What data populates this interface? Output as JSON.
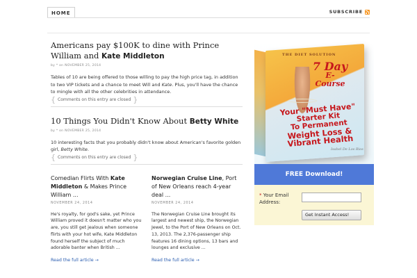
{
  "nav": {
    "home": "HOME",
    "subscribe": "SUBSCRIBE"
  },
  "posts": [
    {
      "title_plain": "Americans pay $100K to dine with Prince William and ",
      "title_bold": "Kate Middleton",
      "meta": "by * on NOVEMBER 25, 2014",
      "excerpt_pre": "Tables of 10 are being offered to those willing to pay the high price tag, in addition to two VIP tickets and a chance to meet Will and ",
      "excerpt_em": "Kate",
      "excerpt_post": ". Plus, you'll have the chance to mingle with all the other celebrities in attendance.",
      "comments": "Comments on this entry are closed"
    },
    {
      "title_plain": "10 Things You Didn't Know About ",
      "title_bold": "Betty White",
      "meta": "by * on NOVEMBER 25, 2014",
      "excerpt_pre": "10 interesting facts that you probably didn't know about American's favorite golden girl, ",
      "excerpt_em": "Betty White",
      "excerpt_post": ".",
      "comments": "Comments on this entry are closed"
    }
  ],
  "columns": [
    {
      "title_pre": "Comedian Flirts With ",
      "title_bold": "Kate Middleton",
      "title_post": " & Makes Prince William ...",
      "date": "NOVEMBER 24, 2014",
      "text": "He's royalty, for god's sake, yet Prince William proved it doesn't matter who you are, you still get jealous when someone flirts with your hot wife, Kate Middleton found herself the subject of much adorable banter when British ...",
      "read_more": "Read the full article →"
    },
    {
      "title_pre": "",
      "title_bold": "Norwegian Cruise Line",
      "title_post": ", Port of New Orleans reach 4-year deal ...",
      "date": "NOVEMBER 24, 2014",
      "text": "The Norwegian Cruise Line brought its largest and newest ship, the Norwegian Jewel, to the Port of New Orleans on Oct. 13, 2013. The 2,376-passenger ship features 16 dining options, 13 bars and lounges and exclusive ...",
      "read_more": "Read the full article →"
    }
  ],
  "sidebar": {
    "product": {
      "brand": "THE DIET SOLUTION",
      "days_num": "7 Day",
      "days_label": "E-Course",
      "line1": "Your \"Must Have\"",
      "line2": "Starter Kit",
      "line3": "To Permanent",
      "line4": "Weight Loss &",
      "line5": "Vibrant Health",
      "signature": "Isabel De Los Rios"
    },
    "free_download": "FREE Download!",
    "email_required": "*",
    "email_label": " Your Email Address:",
    "email_placeholder": "",
    "submit": "Get Instant Access!"
  },
  "colors": {
    "accent_blue": "#4f79d8",
    "signup_bg": "#fbf6d5",
    "link": "#2a5db0",
    "rss": "#f7941d",
    "headline_red": "#c6171c"
  }
}
